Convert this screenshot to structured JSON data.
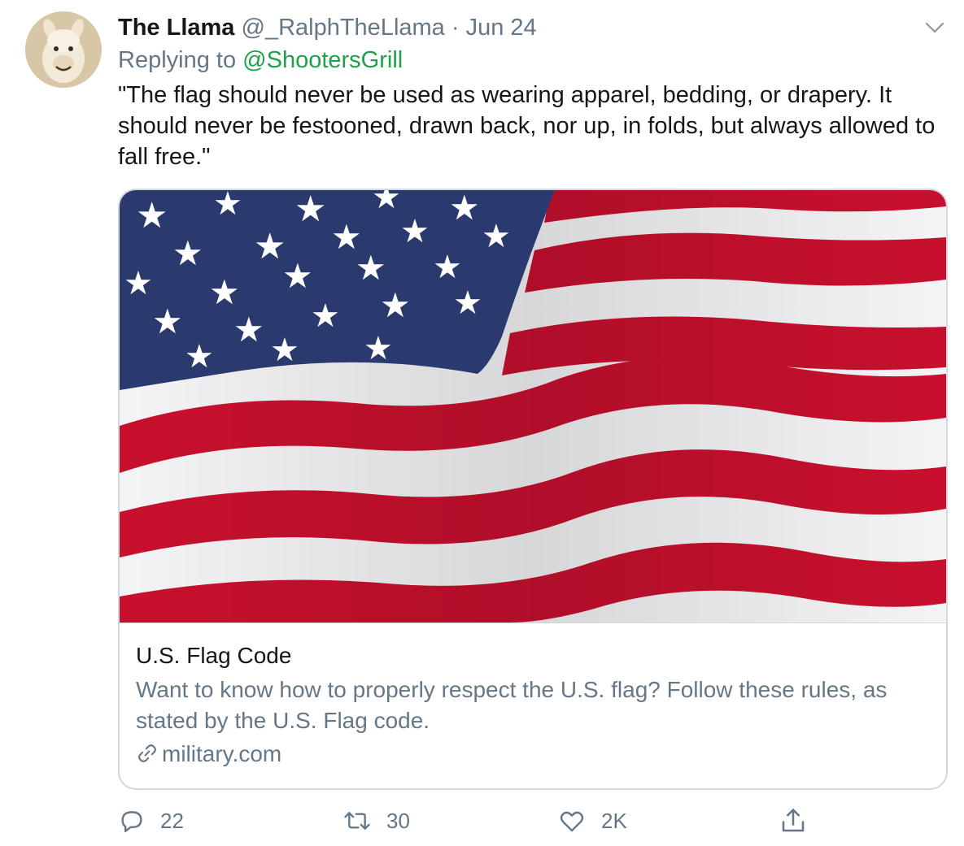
{
  "tweet": {
    "display_name": "The Llama",
    "handle": "@_RalphTheLlama",
    "separator": "·",
    "date": "Jun 24",
    "replying_label": "Replying to",
    "replying_to": "@ShootersGrill",
    "text": "\"The flag should never be used as wearing apparel, bedding, or drapery. It should never be festooned, drawn back, nor up, in folds, but always allowed to fall free.\"",
    "avatar_icon": "llama-avatar",
    "menu_icon": "chevron-down-icon"
  },
  "card": {
    "image_icon": "us-flag-image",
    "title": "U.S. Flag Code",
    "description": "Want to know how to properly respect the U.S. flag? Follow these rules, as stated by the U.S. Flag code.",
    "link_icon": "link-icon",
    "domain": "military.com"
  },
  "actions": {
    "reply_count": "22",
    "retweet_count": "30",
    "like_count": "2K",
    "reply_icon": "reply-icon",
    "retweet_icon": "retweet-icon",
    "like_icon": "heart-icon",
    "share_icon": "share-icon"
  },
  "colors": {
    "accent_green": "#1da14a",
    "muted": "#657786",
    "flag_red": "#c8102e",
    "flag_blue": "#2b3a6e"
  }
}
